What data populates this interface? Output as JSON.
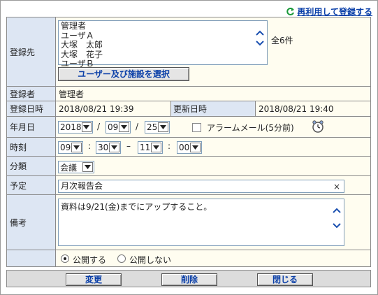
{
  "header": {
    "reuse_label": "再利用して登録する"
  },
  "labels": {
    "recipients": "登録先",
    "registrant": "登録者",
    "registered_at": "登録日時",
    "updated_at": "更新日時",
    "date": "年月日",
    "time": "時刻",
    "category": "分類",
    "title": "予定",
    "memo": "備考"
  },
  "recipients": {
    "items": [
      "管理者",
      "ユーザＡ",
      "大塚　太郎",
      "大塚　花子",
      "ユーザＢ"
    ],
    "count": "全6件",
    "select_button": "ユーザー及び施設を選択"
  },
  "registrant": "管理者",
  "registered_at": "2018/08/21 19:39",
  "updated_at": "2018/08/21 19:40",
  "date": {
    "year": "2018",
    "sep1": "/",
    "month": "09",
    "sep2": "/",
    "day": "25",
    "alarm_label": "アラームメール(5分前)"
  },
  "time": {
    "start_hour": "09",
    "colon1": ":",
    "start_min": "30",
    "dash": "–",
    "end_hour": "11",
    "colon2": ":",
    "end_min": "00"
  },
  "category": "会議",
  "title_value": "月次報告会",
  "clear_glyph": "×",
  "memo": "資料は9/21(金)までにアップすること。",
  "visibility": {
    "public": "公開する",
    "private": "公開しない",
    "selected": "public"
  },
  "buttons": {
    "edit": "変更",
    "delete": "削除",
    "close": "閉じる"
  },
  "colors": {
    "label_bg": "#dde6f3",
    "value_bg": "#fffdf0",
    "link": "#0a3fa8",
    "reuse_icon": "#1a9a3a",
    "arrow": "#1a4fb0"
  }
}
